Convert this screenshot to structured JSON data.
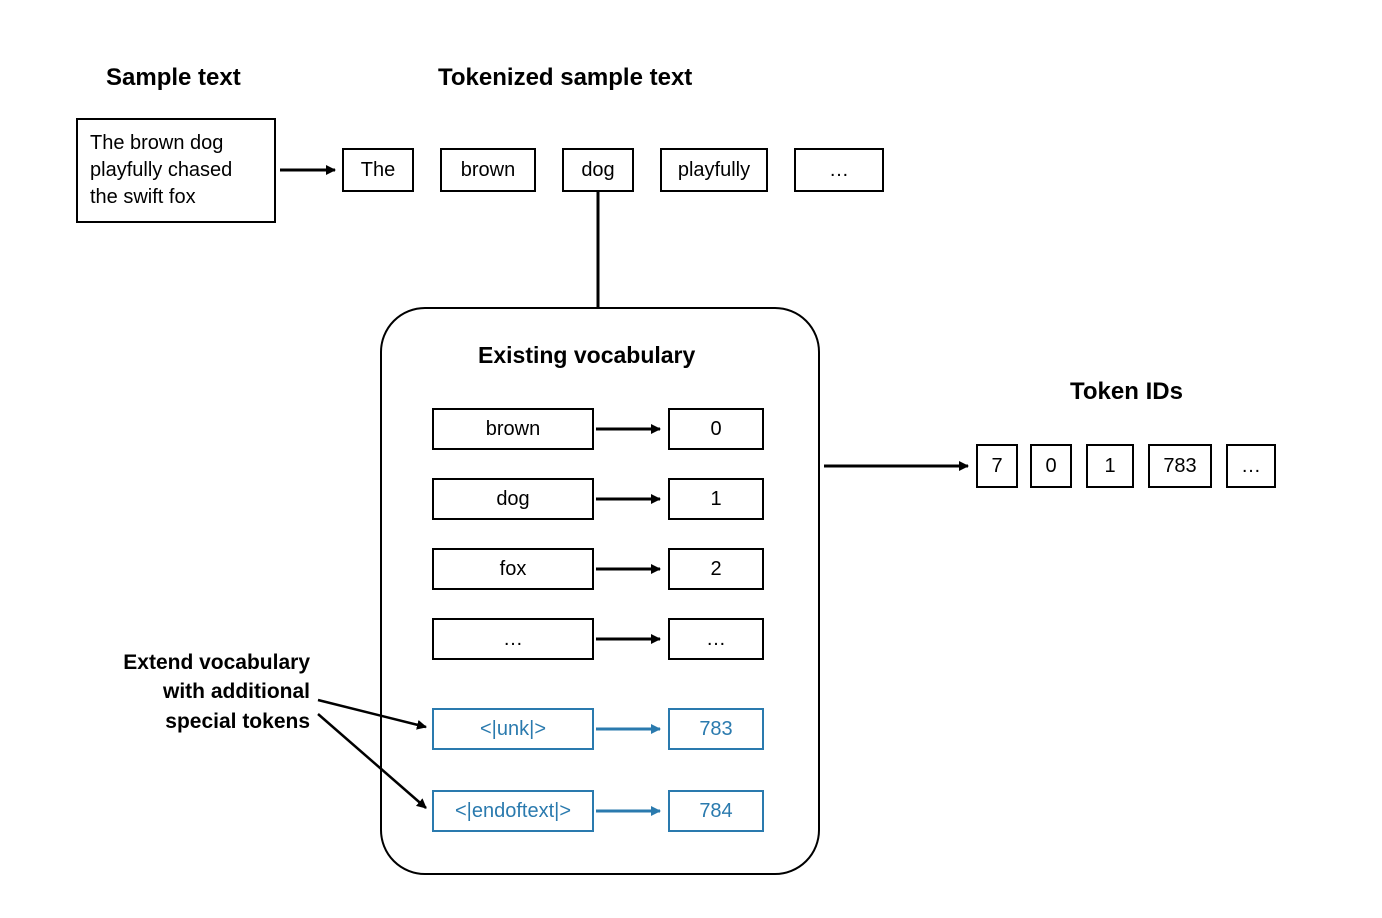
{
  "headings": {
    "sample_text": "Sample text",
    "tokenized": "Tokenized sample text",
    "existing_vocab": "Existing vocabulary",
    "token_ids": "Token IDs"
  },
  "sample": {
    "line1": "The brown dog",
    "line2": "playfully chased",
    "line3": "the swift fox"
  },
  "tokens": [
    "The",
    "brown",
    "dog",
    "playfully",
    "…"
  ],
  "vocab": [
    {
      "word": "brown",
      "id": "0",
      "special": false
    },
    {
      "word": "dog",
      "id": "1",
      "special": false
    },
    {
      "word": "fox",
      "id": "2",
      "special": false
    },
    {
      "word": "…",
      "id": "…",
      "special": false
    },
    {
      "word": "<|unk|>",
      "id": "783",
      "special": true
    },
    {
      "word": "<|endoftext|>",
      "id": "784",
      "special": true
    }
  ],
  "token_ids": [
    "7",
    "0",
    "1",
    "783",
    "…"
  ],
  "side_label": {
    "line1": "Extend vocabulary",
    "line2": "with additional",
    "line3": "special tokens"
  }
}
